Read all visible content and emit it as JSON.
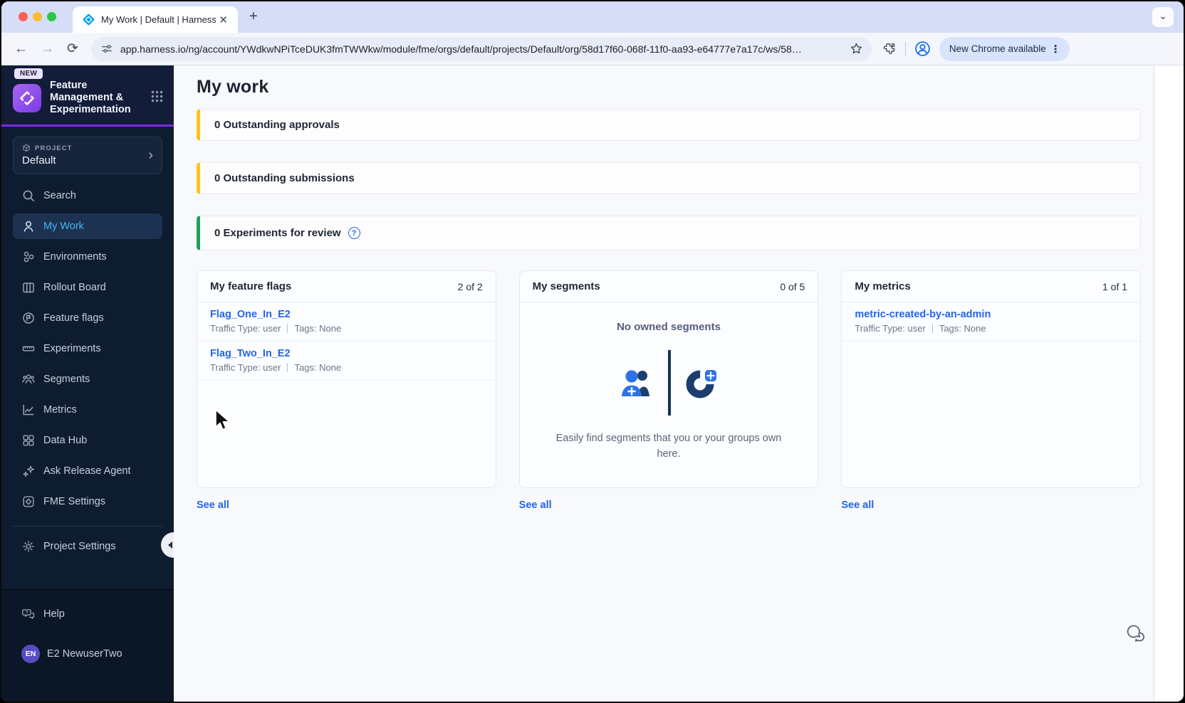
{
  "browser": {
    "tab_title": "My Work | Default | Harness",
    "url": "app.harness.io/ng/account/YWdkwNPiTceDUK3fmTWWkw/module/fme/orgs/default/projects/Default/org/58d17f60-068f-11f0-aa93-e64777e7a17c/ws/58…",
    "update_button": "New Chrome available",
    "close_tab": "✕",
    "new_tab": "+",
    "back": "←",
    "forward": "→",
    "reload": "⟳",
    "strip_chevron": "⌄",
    "kebab": "⋮"
  },
  "sidebar": {
    "new_badge": "NEW",
    "module_title": "Feature Management & Experimentation",
    "project_label": "PROJECT",
    "project_name": "Default",
    "project_chevron": "›",
    "items": [
      {
        "label": "Search",
        "icon": "search-icon",
        "active": false
      },
      {
        "label": "My Work",
        "icon": "user-icon",
        "active": true
      },
      {
        "label": "Environments",
        "icon": "hexagons-icon",
        "active": false
      },
      {
        "label": "Rollout Board",
        "icon": "board-columns-icon",
        "active": false
      },
      {
        "label": "Feature flags",
        "icon": "flag-circle-icon",
        "active": false
      },
      {
        "label": "Experiments",
        "icon": "ruler-icon",
        "active": false
      },
      {
        "label": "Segments",
        "icon": "people-icon",
        "active": false
      },
      {
        "label": "Metrics",
        "icon": "line-chart-icon",
        "active": false
      },
      {
        "label": "Data Hub",
        "icon": "grid-squares-icon",
        "active": false
      },
      {
        "label": "Ask Release Agent",
        "icon": "sparkles-icon",
        "active": false
      },
      {
        "label": "FME Settings",
        "icon": "diamond-square-icon",
        "active": false
      }
    ],
    "project_settings": "Project Settings",
    "help": "Help",
    "user_initials": "EN",
    "user_name": "E2 NewuserTwo"
  },
  "main": {
    "title": "My work",
    "banners": [
      {
        "text": "0 Outstanding approvals",
        "accent_color": "#fcc31c"
      },
      {
        "text": "0 Outstanding submissions",
        "accent_color": "#fcc31c"
      },
      {
        "text": "0 Experiments for review",
        "accent_color": "#1fa05c",
        "help_icon": "?"
      }
    ],
    "cards": [
      {
        "title": "My feature flags",
        "count": "2 of 2",
        "items": [
          {
            "name": "Flag_One_In_E2",
            "traffic": "Traffic Type: user",
            "tags": "Tags: None"
          },
          {
            "name": "Flag_Two_In_E2",
            "traffic": "Traffic Type: user",
            "tags": "Tags: None"
          }
        ],
        "see_all": "See all"
      },
      {
        "title": "My segments",
        "count": "0 of 5",
        "empty_heading": "No owned segments",
        "empty_description": "Easily find segments that you or your groups own here.",
        "see_all": "See all"
      },
      {
        "title": "My metrics",
        "count": "1 of 1",
        "items": [
          {
            "name": "metric-created-by-an-admin",
            "traffic": "Traffic Type: user",
            "tags": "Tags: None"
          }
        ],
        "see_all": "See all"
      }
    ]
  },
  "colors": {
    "accent_purple": "#7d2ae8",
    "active_item_text": "#45b5f5",
    "link_blue": "#2264ec",
    "banner_yellow": "#fcc31c",
    "banner_green": "#1fa05c",
    "sidebar_bg": "#0e1c30"
  }
}
